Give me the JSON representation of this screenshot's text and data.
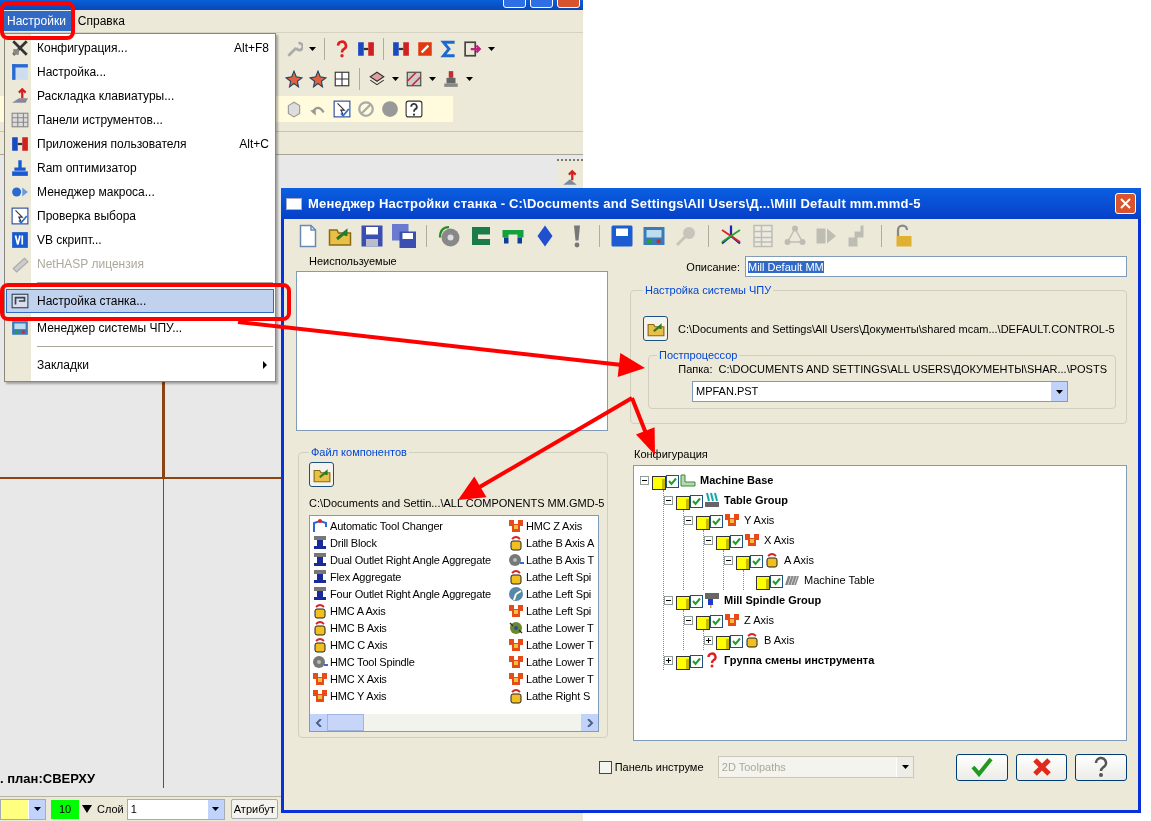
{
  "app": {
    "menubar": [
      {
        "label": "Настройки",
        "selected": true
      },
      {
        "label": "Справка",
        "selected": false
      }
    ],
    "menu": [
      {
        "kind": "item",
        "label": "Конфигурация...",
        "shortcut": "Alt+F8",
        "disabled": false,
        "selected": false
      },
      {
        "kind": "item",
        "label": "Настройка...",
        "disabled": false,
        "selected": false
      },
      {
        "kind": "item",
        "label": "Раскладка клавиатуры...",
        "disabled": false,
        "selected": false
      },
      {
        "kind": "item",
        "label": "Панели иструментов...",
        "disabled": false,
        "selected": false
      },
      {
        "kind": "item",
        "label": "Приложения пользователя",
        "shortcut": "Alt+C",
        "disabled": false,
        "selected": false
      },
      {
        "kind": "item",
        "label": "Ram оптимизатор",
        "disabled": false,
        "selected": false
      },
      {
        "kind": "item",
        "label": "Менеджер макроса...",
        "disabled": false,
        "selected": false
      },
      {
        "kind": "item",
        "label": "Проверка выбора",
        "disabled": false,
        "selected": false
      },
      {
        "kind": "item",
        "label": "VB скрипт...",
        "disabled": false,
        "selected": false
      },
      {
        "kind": "item",
        "label": "NetHASP лицензия",
        "disabled": true,
        "selected": false
      },
      {
        "kind": "separator"
      },
      {
        "kind": "item",
        "label": "Настройка станка...",
        "disabled": false,
        "selected": true
      },
      {
        "kind": "item",
        "label": "Менеджер системы ЧПУ...",
        "disabled": false,
        "selected": false
      },
      {
        "kind": "separator"
      },
      {
        "kind": "item",
        "label": "Закладки",
        "disabled": false,
        "selected": false,
        "submenu": true
      }
    ],
    "view_label": ". план:СВЕРХУ",
    "status_bar": {
      "width_value": "10",
      "layer_label": "Слой",
      "layer_value": "1",
      "attributes_button": "Атрибут"
    }
  },
  "dialog": {
    "title": "Менеджер Настройки станка - C:\\Documents and Settings\\All Users\\Д...\\Mill Default mm.mmd-5",
    "toolbar": [
      {
        "disabled": false
      },
      {
        "disabled": false
      },
      {
        "disabled": false
      },
      {
        "disabled": false
      },
      {
        "disabled": false
      },
      {
        "disabled": false
      },
      {
        "disabled": false
      },
      {
        "disabled": false
      },
      {
        "disabled": false
      },
      {
        "disabled": false
      },
      {
        "disabled": false
      },
      {
        "disabled": true
      },
      {
        "disabled": false
      },
      {
        "disabled": true
      },
      {
        "disabled": true
      },
      {
        "disabled": true
      },
      {
        "disabled": true
      },
      {
        "disabled": false
      }
    ],
    "unused_label": "Неиспользуемые",
    "description": {
      "label": "Описание:",
      "value": "Mill Default MM",
      "selected": true
    },
    "control_group": {
      "title": "Настройка системы ЧПУ",
      "path": "C:\\Documents and Settings\\All Users\\Документы\\shared mcam...\\DEFAULT.CONTROL-5",
      "post": {
        "title": "Постпроцессор",
        "folder_label": "Папка:",
        "folder_path": "C:\\DOCUMENTS AND SETTINGS\\ALL USERS\\ДОКУМЕНТЫ\\SHAR...\\POSTS",
        "file": "MPFAN.PST"
      }
    },
    "components": {
      "title": "Файл компонентов",
      "path": "C:\\Documents and Settin...\\ALL COMPONENTS MM.GMD-5",
      "items": [
        {
          "label": "Automatic Tool Changer",
          "kind": "changer"
        },
        {
          "label": "Drill Block",
          "kind": "block"
        },
        {
          "label": "Dual Outlet Right Angle Aggregate",
          "kind": "block"
        },
        {
          "label": "Flex Aggregate",
          "kind": "block"
        },
        {
          "label": "Four Outlet Right Angle Aggregate",
          "kind": "block"
        },
        {
          "label": "HMC A Axis",
          "kind": "rotary_axis"
        },
        {
          "label": "HMC B Axis",
          "kind": "rotary_axis"
        },
        {
          "label": "HMC C Axis",
          "kind": "rotary_axis"
        },
        {
          "label": "HMC Tool Spindle",
          "kind": "spindle"
        },
        {
          "label": "HMC X Axis",
          "kind": "linear_axis"
        },
        {
          "label": "HMC Y Axis",
          "kind": "linear_axis"
        },
        {
          "label": "HMC Z Axis",
          "kind": "linear_axis"
        },
        {
          "label": "Lathe B Axis A",
          "kind": "rotary_axis"
        },
        {
          "label": "Lathe B Axis T",
          "kind": "spindle"
        },
        {
          "label": "Lathe Left Spi",
          "kind": "rotary_axis"
        },
        {
          "label": "Lathe Left Spi",
          "kind": "chuck"
        },
        {
          "label": "Lathe Left Spi",
          "kind": "linear_axis"
        },
        {
          "label": "Lathe Lower T",
          "kind": "turret"
        },
        {
          "label": "Lathe Lower T",
          "kind": "linear_axis"
        },
        {
          "label": "Lathe Lower T",
          "kind": "linear_axis"
        },
        {
          "label": "Lathe Lower T",
          "kind": "linear_axis"
        },
        {
          "label": "Lathe Right S",
          "kind": "rotary_axis"
        }
      ]
    },
    "config_label": "Конфигурация",
    "tree": [
      {
        "label": "Machine Base",
        "kind": "base",
        "checked": true,
        "expanded": true,
        "children": [
          {
            "label": "Table Group",
            "kind": "table_group",
            "checked": true,
            "expanded": true,
            "children": [
              {
                "label": "Y Axis",
                "kind": "linear_axis",
                "checked": true,
                "expanded": true,
                "children": [
                  {
                    "label": "X Axis",
                    "kind": "linear_axis",
                    "checked": true,
                    "expanded": true,
                    "children": [
                      {
                        "label": "A Axis",
                        "kind": "rotary_axis",
                        "checked": true,
                        "expanded": true,
                        "children": [
                          {
                            "label": "Machine Table",
                            "kind": "table",
                            "checked": true
                          }
                        ]
                      }
                    ]
                  }
                ]
              }
            ]
          },
          {
            "label": "Mill Spindle Group",
            "kind": "spindle_group",
            "checked": true,
            "expanded": true,
            "children": [
              {
                "label": "Z Axis",
                "kind": "linear_axis",
                "checked": true,
                "expanded": true,
                "children": [
                  {
                    "label": "B Axis",
                    "kind": "rotary_axis",
                    "checked": true,
                    "expanded": false
                  }
                ]
              }
            ]
          },
          {
            "label": "Группа смены инструмента",
            "kind": "tool_change_group",
            "checked": true,
            "expanded": false
          }
        ]
      }
    ],
    "toolbar_checkbox": {
      "label": "Панель инструме",
      "checked": false
    },
    "toolbar_combo": {
      "value": "2D Toolpaths",
      "disabled": true
    }
  }
}
